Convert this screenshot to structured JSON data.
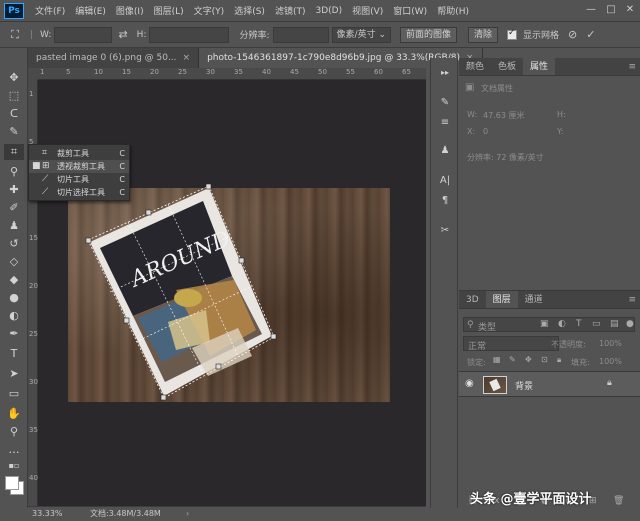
{
  "menubar": {
    "app_icon": "Ps",
    "items": [
      "文件(F)",
      "编辑(E)",
      "图像(I)",
      "图层(L)",
      "文字(Y)",
      "选择(S)",
      "滤镜(T)",
      "3D(D)",
      "视图(V)",
      "窗口(W)",
      "帮助(H)"
    ]
  },
  "options": {
    "w_label": "W:",
    "h_label": "H:",
    "resolution_label": "分辨率:",
    "unit_select": "像素/英寸",
    "front_image_button": "前面的图像",
    "clear_button": "清除",
    "show_grid_label": "显示网格",
    "show_grid_checked": true
  },
  "doc_tabs": [
    {
      "label": "pasted image 0 (6).png @ 50...",
      "active": false
    },
    {
      "label": "photo-1546361897-1c790e8d96b9.jpg @ 33.3%(RGB/8)",
      "active": true
    }
  ],
  "ruler_h_labels": [
    "1",
    "5",
    "10",
    "15",
    "20",
    "25",
    "30",
    "35",
    "40",
    "45",
    "50",
    "55",
    "60",
    "65"
  ],
  "ruler_v_labels": [
    "1",
    "5",
    "10",
    "15",
    "20",
    "25",
    "30",
    "35",
    "40"
  ],
  "flyout": {
    "items": [
      {
        "label": "裁剪工具",
        "key": "C",
        "icon": "crop-icon",
        "selected": false,
        "marker": ""
      },
      {
        "label": "透视裁剪工具",
        "key": "C",
        "icon": "perspective-crop-icon",
        "selected": true,
        "marker": "■"
      },
      {
        "label": "切片工具",
        "key": "C",
        "icon": "slice-icon",
        "selected": false,
        "marker": ""
      },
      {
        "label": "切片选择工具",
        "key": "C",
        "icon": "slice-select-icon",
        "selected": false,
        "marker": ""
      }
    ]
  },
  "canvas": {
    "card_text": "AROUND"
  },
  "status": {
    "zoom": "33.33%",
    "doc_info": "文档:3.48M/3.48M"
  },
  "properties_panel": {
    "tabs": [
      "颜色",
      "色板",
      "属性"
    ],
    "active_tab": "属性",
    "doc_properties": "文档属性",
    "w_label": "W:",
    "w_value": "47.63 厘米",
    "h_label": "H:",
    "x_label": "X:",
    "x_value": "0",
    "y_label": "Y:",
    "resolution": "分辨率: 72 像素/英寸"
  },
  "layers_panel": {
    "tabs": [
      "3D",
      "图层",
      "通道"
    ],
    "active_tab": "图层",
    "filter_kind": "类型",
    "blend_mode": "正常",
    "opacity_label": "不透明度:",
    "opacity_value": "100%",
    "lock_label": "锁定:",
    "fill_label": "填充:",
    "fill_value": "100%",
    "layer_name": "背景"
  },
  "watermark": "头条 @壹学平面设计"
}
